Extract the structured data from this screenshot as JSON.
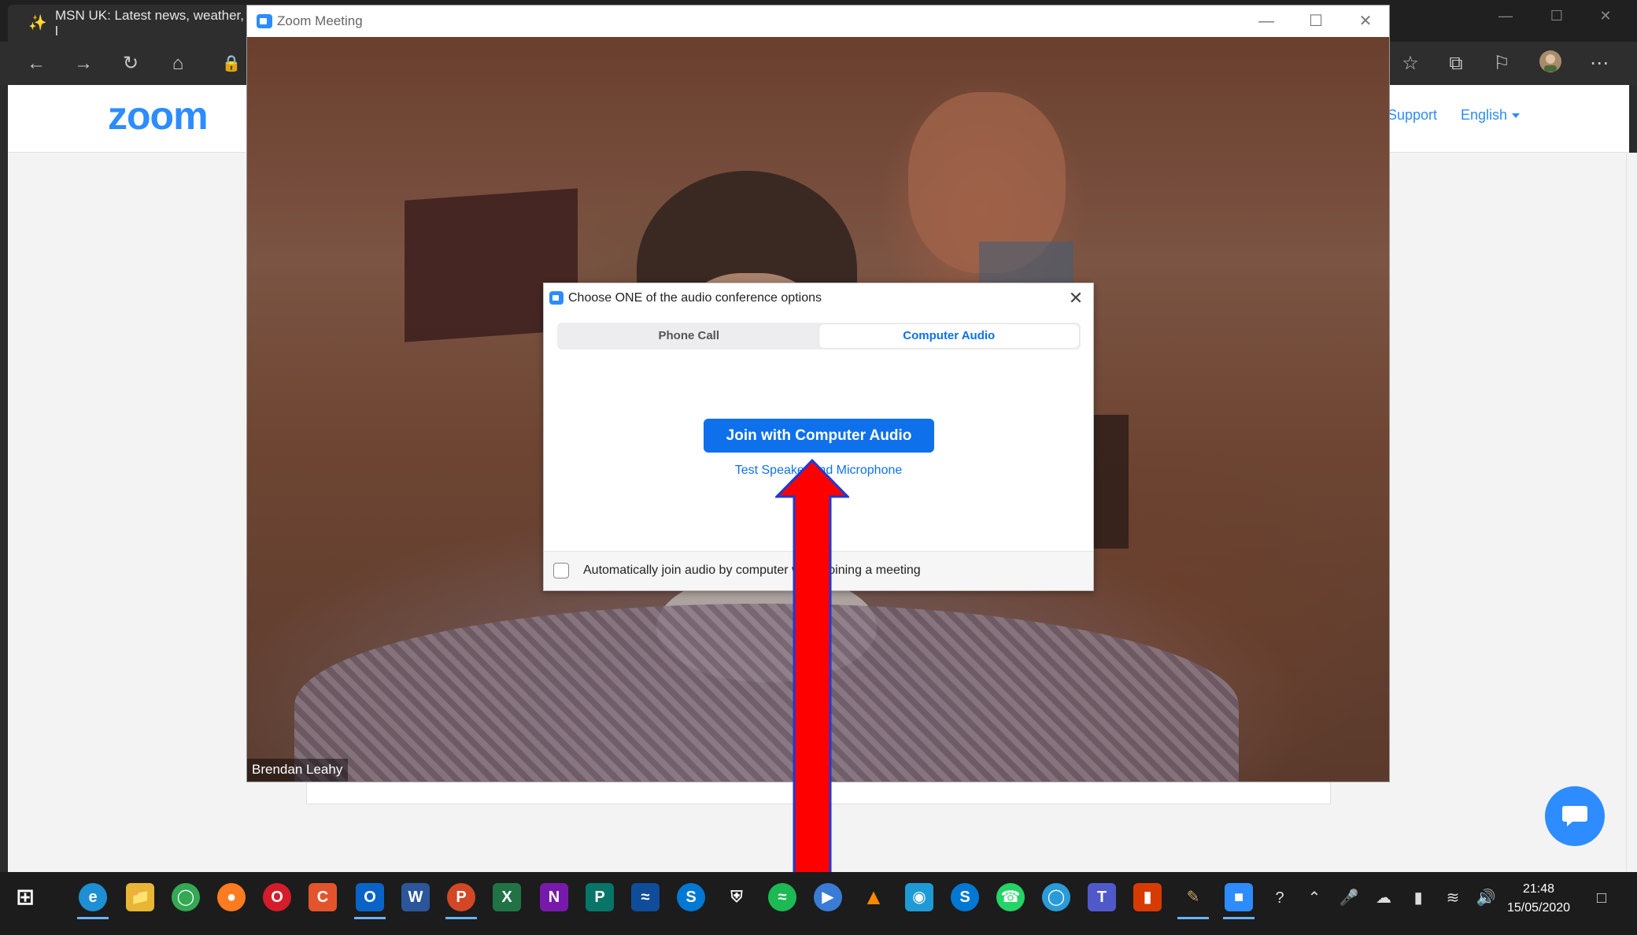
{
  "browser": {
    "tab_title": "MSN UK: Latest news, weather, l"
  },
  "zoom_site": {
    "logo": "zoom",
    "support_link": "Support",
    "language_selector": "English"
  },
  "zoom_window": {
    "title": "Zoom Meeting",
    "participant_name": "Brendan Leahy"
  },
  "audio_dialog": {
    "title": "Choose ONE of the audio conference options",
    "tabs": [
      {
        "label": "Phone Call",
        "active": false
      },
      {
        "label": "Computer Audio",
        "active": true
      }
    ],
    "join_button": "Join with Computer Audio",
    "test_link": "Test Speaker and Microphone",
    "auto_join_label": "Automatically join audio by computer when joining a meeting",
    "auto_join_checked": false
  },
  "taskbar": {
    "time": "21:48",
    "date": "15/05/2020"
  },
  "colors": {
    "zoom_blue": "#2d8cff",
    "button_blue": "#0e71eb",
    "annotation_arrow": "#ff0000"
  }
}
